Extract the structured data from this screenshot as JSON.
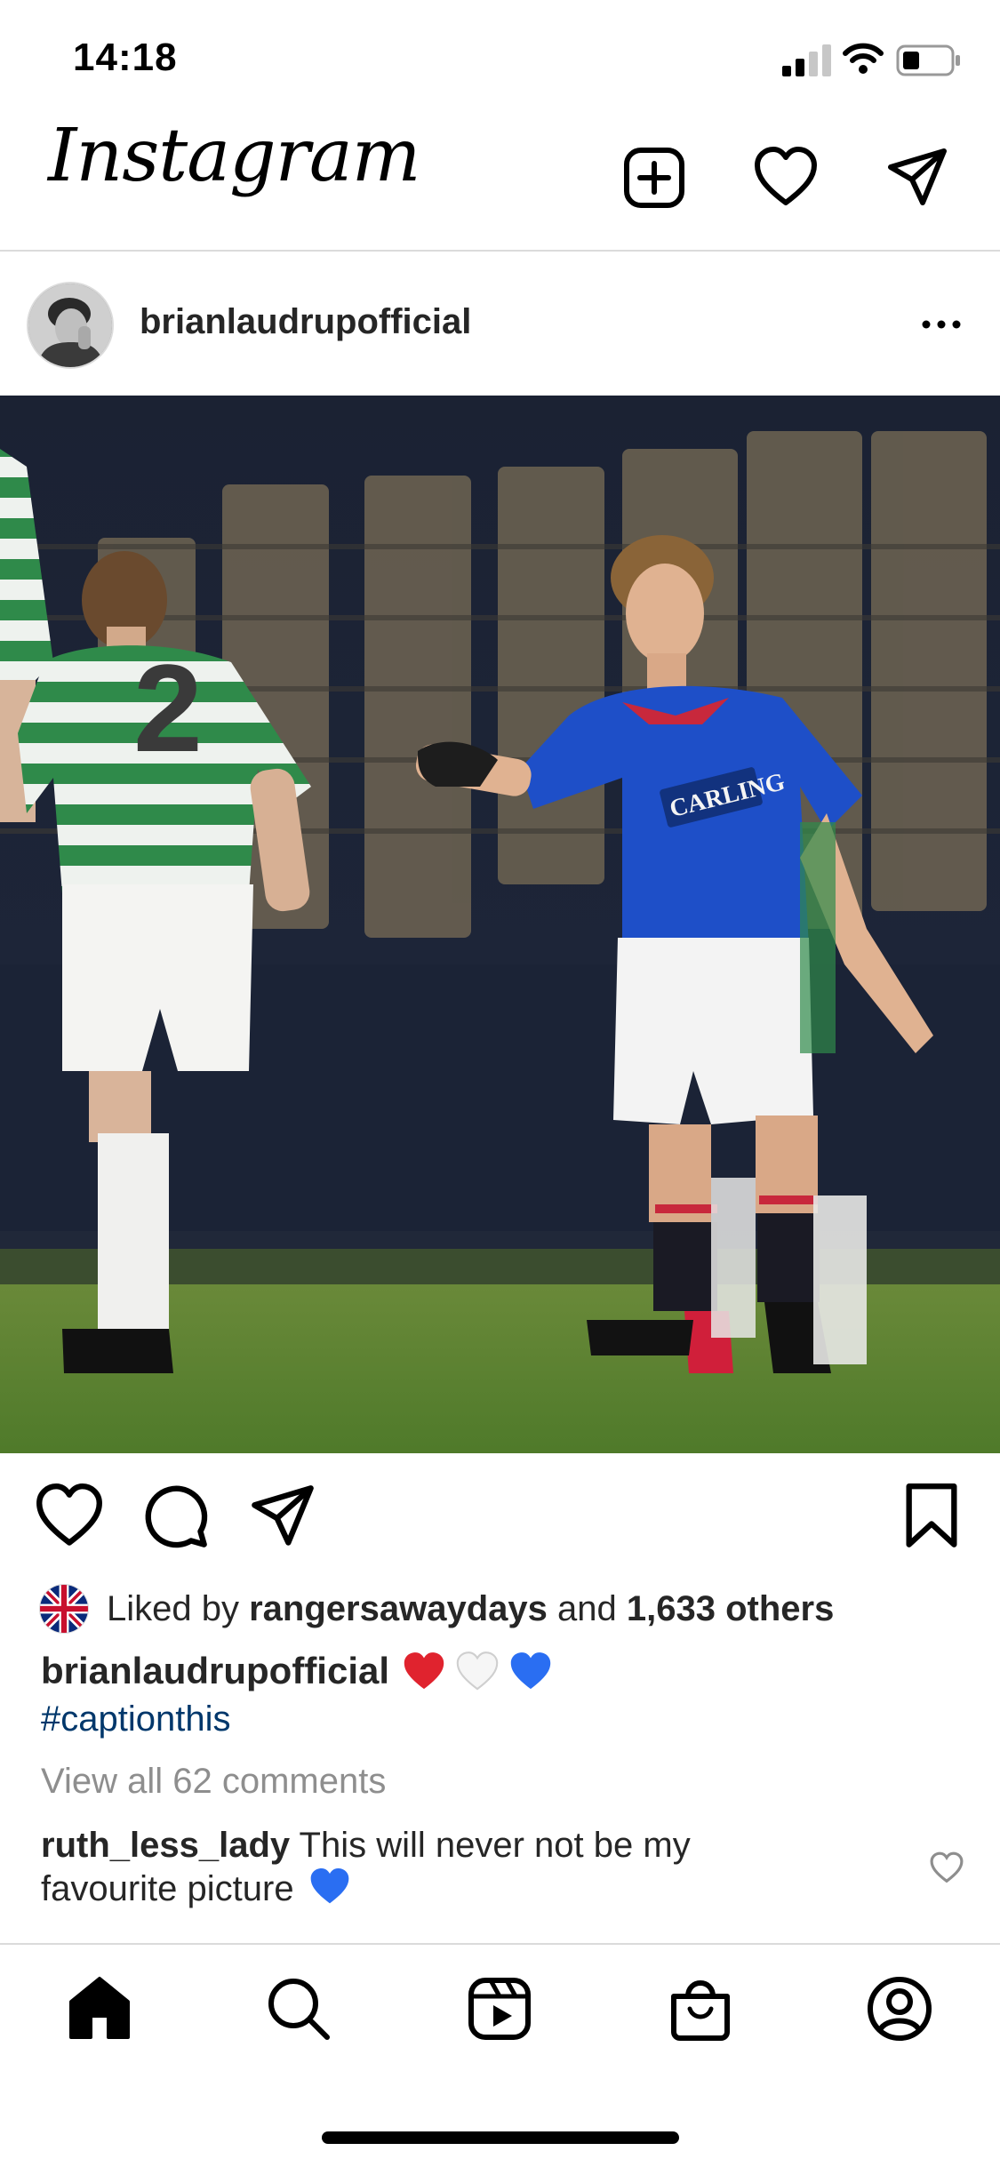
{
  "status_bar": {
    "time": "14:18"
  },
  "header": {
    "logo": "Instagram",
    "icons": [
      "new-post-icon",
      "heart-icon",
      "direct-message-icon"
    ]
  },
  "post": {
    "username": "brianlaudrupofficial",
    "likes": {
      "prefix": "Liked by",
      "liker": "rangersawaydays",
      "middle": "and",
      "count": "1,633 others"
    },
    "caption": {
      "username": "brianlaudrupofficial",
      "hashtag": "#captionthis"
    },
    "view_comments": "View all 62 comments",
    "comment": {
      "username": "ruth_less_lady",
      "text": "This will never not be my favourite picture"
    }
  },
  "colors": {
    "link": "#00376b",
    "muted": "#8e8e8e",
    "red_heart": "#e0232e",
    "blue_heart": "#2a6ef2",
    "rangers_blue": "#1e4fc8"
  },
  "nav": [
    "home-icon",
    "search-icon",
    "reels-icon",
    "shop-icon",
    "profile-icon"
  ]
}
